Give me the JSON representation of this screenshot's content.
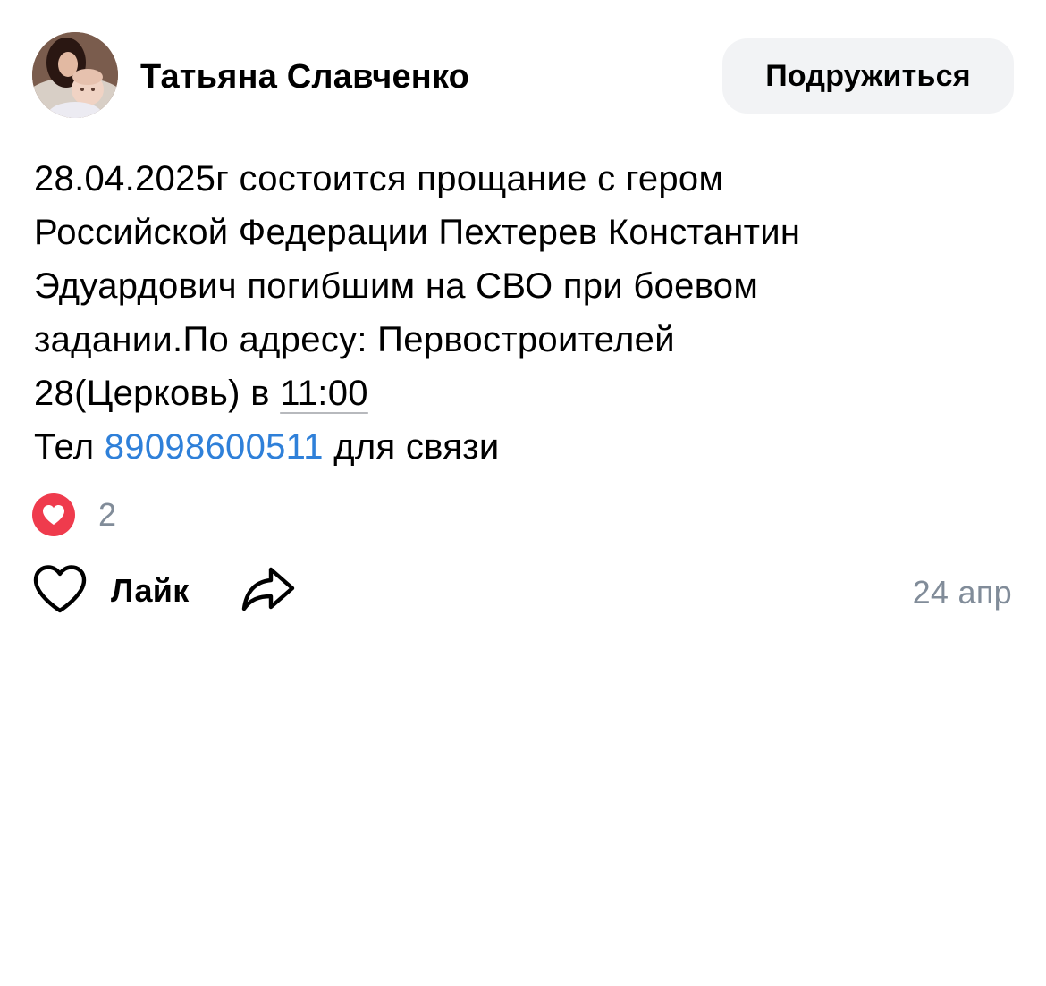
{
  "author": {
    "name": "Татьяна Славченко",
    "avatar_alt": "avatar"
  },
  "header": {
    "add_friend_label": "Подружиться"
  },
  "post": {
    "line1": "28.04.2025г состоится прощание с гером",
    "line2": "Российской Федерации Пехтерев Константин",
    "line3": "Эдуардович погибшим на СВО при боевом",
    "line4": "задании.По адресу: Первостроителей",
    "line5_prefix": "28(Церковь) в ",
    "line5_time": "11:00",
    "line6_prefix": "Тел ",
    "line6_phone": "89098600511",
    "line6_suffix": " для связи"
  },
  "reactions": {
    "icon": "heart-filled-icon",
    "count": "2",
    "color": "#ef3b4d"
  },
  "actions": {
    "like_icon": "heart-outline-icon",
    "like_label": "Лайк",
    "share_icon": "share-arrow-icon",
    "date": "24 апр"
  },
  "colors": {
    "link": "#2f80d9",
    "secondary_text": "#818c99",
    "button_bg": "#f2f3f5"
  }
}
